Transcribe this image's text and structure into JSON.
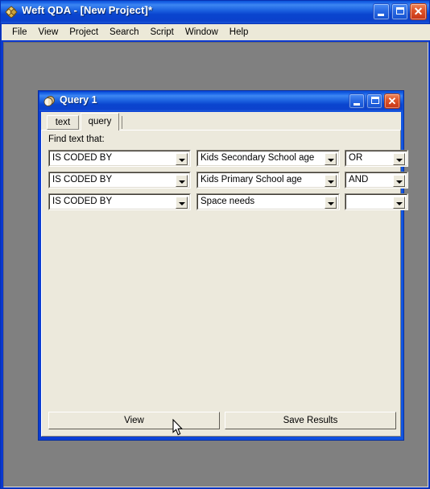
{
  "app": {
    "title": "Weft QDA - [New Project]*",
    "icon": "weft-logo-icon",
    "window_buttons": {
      "minimize": "minimize",
      "maximize": "maximize",
      "close": "close"
    }
  },
  "menubar": {
    "items": [
      {
        "label": "File"
      },
      {
        "label": "View"
      },
      {
        "label": "Project"
      },
      {
        "label": "Search"
      },
      {
        "label": "Script"
      },
      {
        "label": "Window"
      },
      {
        "label": "Help"
      }
    ]
  },
  "query_window": {
    "title": "Query 1",
    "icon": "query-disc-icon",
    "window_buttons": {
      "minimize": "minimize",
      "maximize": "maximize",
      "close": "close"
    },
    "tabs": [
      {
        "label": "text",
        "active": false
      },
      {
        "label": "query",
        "active": true
      }
    ],
    "find_label": "Find text that:",
    "rows": [
      {
        "condition": "IS CODED BY",
        "value": "Kids Secondary School age",
        "operator": "OR"
      },
      {
        "condition": "IS CODED BY",
        "value": "Kids Primary School age",
        "operator": "AND"
      },
      {
        "condition": "IS CODED BY",
        "value": "Space needs",
        "operator": ""
      }
    ],
    "buttons": {
      "view": "View",
      "save_results": "Save Results"
    }
  },
  "colors": {
    "titlebar_blue": "#0a45cf",
    "titlebar_highlight": "#3d87f2",
    "close_red": "#e0552a",
    "panel_beige": "#ece9dc",
    "mdi_gray": "#808080",
    "menubar": "#ece9d8",
    "text_black": "#000000",
    "field_white": "#ffffff"
  }
}
